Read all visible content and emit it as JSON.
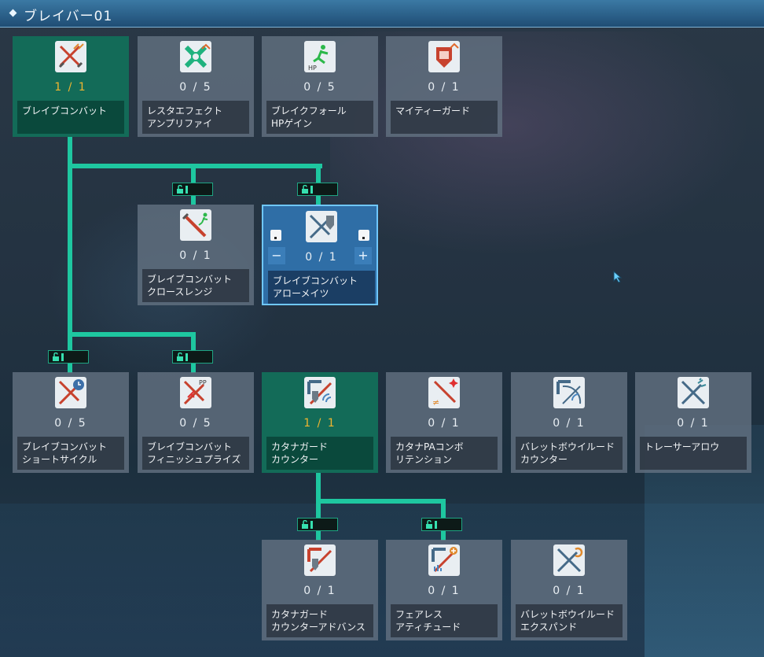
{
  "header": {
    "title": "ブレイバー01"
  },
  "colors": {
    "connector": "#1ec7a0",
    "learned_card": "#136b58",
    "learned_count": "#f0b530",
    "selected_border": "#6fc7ff"
  },
  "skills": {
    "brave_combat": {
      "count": "1 / 1",
      "name": "ブレイブコンバット",
      "icon": "crossed-swords-icon",
      "state": "learned"
    },
    "resta_effect_amplify": {
      "count": "0 / 5",
      "name": "レスタエフェクト\nアンプリファイ",
      "icon": "resta-effect-icon",
      "state": "locked"
    },
    "break_fall_hp_gain": {
      "count": "0 / 5",
      "name": "ブレイクフォール\nHPゲイン",
      "icon": "break-fall-icon",
      "state": "locked"
    },
    "mighty_guard": {
      "count": "0 / 1",
      "name": "マイティーガード",
      "icon": "mighty-guard-icon",
      "state": "locked"
    },
    "brave_combat_close_range": {
      "count": "0 / 1",
      "name": "ブレイブコンバット\nクロースレンジ",
      "icon": "sword-runner-icon",
      "state": "available"
    },
    "brave_combat_arrow_mates": {
      "count": "0 / 1",
      "name": "ブレイブコンバット\nアローメイツ",
      "icon": "bow-shield-icon",
      "state": "selected"
    },
    "brave_combat_short_cycle": {
      "count": "0 / 5",
      "name": "ブレイブコンバット\nショートサイクル",
      "icon": "swords-clock-icon",
      "state": "available"
    },
    "brave_combat_finish_prize": {
      "count": "0 / 5",
      "name": "ブレイブコンバット\nフィニッシュプライズ",
      "icon": "swords-pp-icon",
      "state": "available"
    },
    "katana_guard_counter": {
      "count": "1 / 1",
      "name": "カタナガード\nカウンター",
      "icon": "katana-guard-icon",
      "state": "learned"
    },
    "katana_pa_combo_retention": {
      "count": "0 / 1",
      "name": "カタナPAコンボ\nリテンション",
      "icon": "katana-combo-icon",
      "state": "locked"
    },
    "bullet_bow_wild_counter": {
      "count": "0 / 1",
      "name": "バレットボウイルード\nカウンター",
      "icon": "bow-counter-icon",
      "state": "locked"
    },
    "tracer_arrow": {
      "count": "0 / 1",
      "name": "トレーサーアロウ",
      "icon": "tracer-arrow-icon",
      "state": "locked"
    },
    "katana_guard_counter_advance": {
      "count": "0 / 1",
      "name": "カタナガード\nカウンターアドバンス",
      "icon": "katana-advance-icon",
      "state": "available"
    },
    "fearless_attitude": {
      "count": "0 / 1",
      "name": "フェアレス\nアティチュード",
      "icon": "fearless-icon",
      "state": "available"
    },
    "bullet_bow_wild_expand": {
      "count": "0 / 1",
      "name": "バレットボウイルード\nエクスパンド",
      "icon": "bow-expand-icon",
      "state": "locked"
    }
  },
  "controls": {
    "minus": "−",
    "plus": "+"
  }
}
